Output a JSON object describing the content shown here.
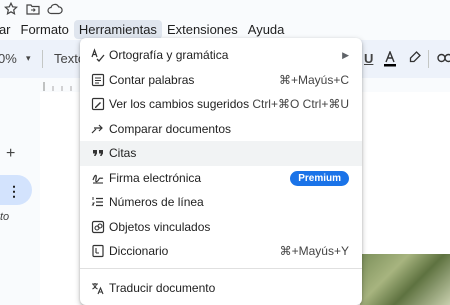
{
  "menubar": {
    "items": [
      "rtar",
      "Formato",
      "Herramientas",
      "Extensiones",
      "Ayuda"
    ]
  },
  "toolbar": {
    "zoom": "0%",
    "style": "Texto"
  },
  "left_panel": {
    "partial_text": "to"
  },
  "tools_menu": {
    "items": [
      {
        "label": "Ortografía y gramática",
        "icon": "spellcheck-icon",
        "submenu": true
      },
      {
        "label": "Contar palabras",
        "icon": "word-count-icon",
        "shortcut": "⌘+Mayús+C"
      },
      {
        "label": "Ver los cambios sugeridos",
        "icon": "suggested-edits-icon",
        "shortcut": "Ctrl+⌘O Ctrl+⌘U"
      },
      {
        "label": "Comparar documentos",
        "icon": "compare-icon"
      },
      {
        "label": "Citas",
        "icon": "quote-icon"
      },
      {
        "label": "Firma electrónica",
        "icon": "signature-icon",
        "badge": "Premium"
      },
      {
        "label": "Números de línea",
        "icon": "line-numbers-icon"
      },
      {
        "label": "Objetos vinculados",
        "icon": "linked-objects-icon"
      },
      {
        "label": "Diccionario",
        "icon": "dictionary-icon",
        "shortcut": "⌘+Mayús+Y"
      },
      {
        "label": "Traducir documento",
        "icon": "translate-icon"
      }
    ],
    "hovered": "Citas"
  },
  "colors": {
    "menu_active_bg": "#dfe5ee",
    "premium_badge": "#1a73e8",
    "side_pill": "#d3e3fd",
    "toolbar_bg": "#edf2fa"
  }
}
